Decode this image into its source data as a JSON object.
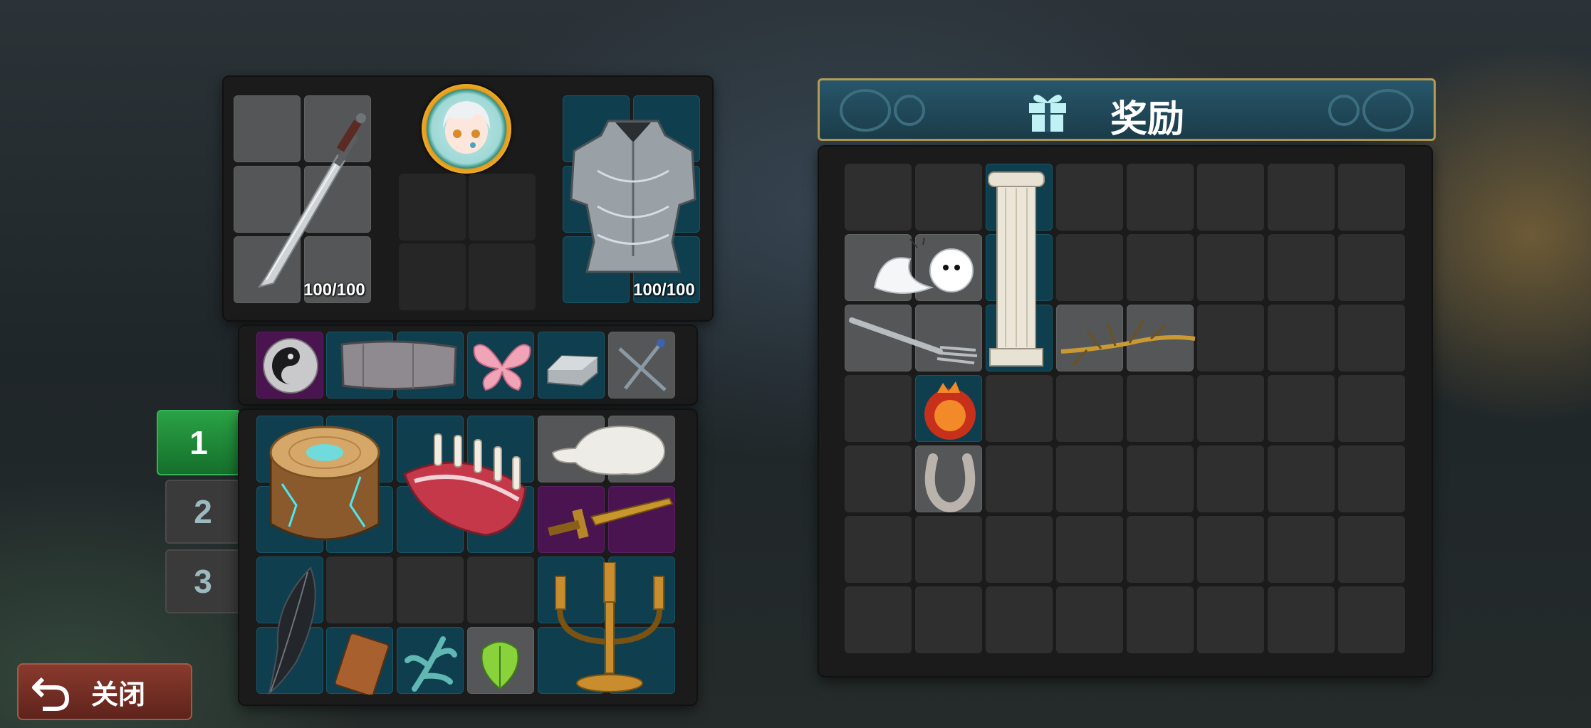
{
  "equipment": {
    "weapon_durability": "100/100",
    "armor_durability": "100/100"
  },
  "bag_tabs": [
    "1",
    "2",
    "3"
  ],
  "active_tab": "1",
  "close_button": {
    "label": "关闭"
  },
  "rewards": {
    "title": "奖励"
  },
  "icons": {
    "sword": "sword-icon",
    "avatar": "character-portrait",
    "armor": "plate-armor-icon",
    "orb": "yin-yang-orb-icon",
    "bracer": "bracer-icon",
    "butterfly": "butterfly-icon",
    "ingot": "silver-ingot-icon",
    "nails": "crossed-nails-icon",
    "stump": "magic-stump-icon",
    "ribs": "meat-ribs-icon",
    "skull": "bone-skull-icon",
    "dagger": "golden-dagger-icon",
    "feather": "black-feather-icon",
    "card": "card-icon",
    "herb": "blue-herb-icon",
    "leaf": "green-leaf-icon",
    "candelabra": "candelabra-icon",
    "ghost": "teru-teru-bozu-icon",
    "column": "stone-column-icon",
    "fork": "fork-icon",
    "branch": "branch-icon",
    "fireball": "fire-orb-icon",
    "horseshoe": "horseshoe-icon",
    "gift": "gift-icon",
    "undo": "undo-arrow-icon"
  },
  "colors": {
    "teal_slot": "#0f3f4f",
    "purple_slot": "#4a1450",
    "grey_slot": "#555657",
    "active_tab": "#1a7a32",
    "close_button": "#7a3328",
    "reward_banner": "#1e4452"
  }
}
